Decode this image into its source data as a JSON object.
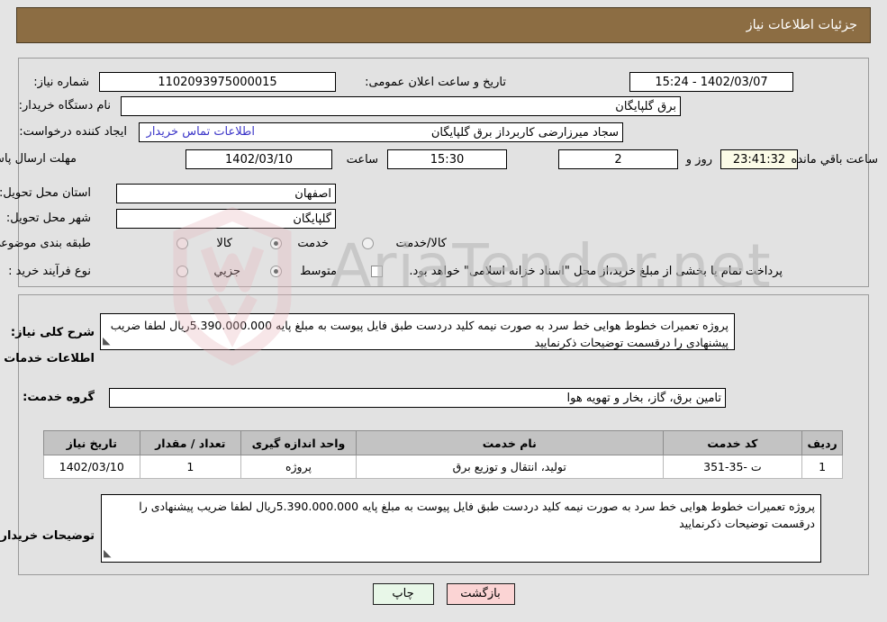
{
  "header": {
    "title": "جزئیات اطلاعات نیاز"
  },
  "colors": {
    "header_bg": "#8c6d43",
    "panel_bg": "#e2e2e2",
    "page_bg": "#e4e4e4",
    "link": "#3b35c8",
    "table_header_bg": "#c3c3c3",
    "print_btn_bg": "#e8f7e8",
    "back_btn_bg": "#fbd4d4",
    "countdown_bg": "#fbfbe7"
  },
  "form": {
    "need_number_label": "شماره نیاز:",
    "need_number_value": "1102093975000015",
    "announce_datetime_label": "تاریخ و ساعت اعلان عمومی:",
    "announce_datetime_value": "1402/03/07 - 15:24",
    "buyer_org_label": "نام دستگاه خریدار:",
    "buyer_org_value": "برق گلپایگان",
    "creator_label": "ایجاد کننده درخواست:",
    "creator_value": "سجاد میرزارضی کاربرداز برق گلپایگان",
    "contact_link": "اطلاعات تماس خریدار",
    "deadline_label": "مهلت ارسال پاسخ: تا تاریخ:",
    "deadline_date": "1402/03/10",
    "hour_label": "ساعت",
    "deadline_time": "15:30",
    "days_value": "2",
    "days_label": "روز و",
    "countdown_value": "23:41:32",
    "remaining_label": "ساعت باقي مانده",
    "province_label": "استان محل تحویل:",
    "province_value": "اصفهان",
    "city_label": "شهر محل تحویل:",
    "city_value": "گلپایگان",
    "category_label": "طبقه بندی موضوعی:",
    "category_options": [
      {
        "label": "کالا",
        "selected": false
      },
      {
        "label": "خدمت",
        "selected": true
      },
      {
        "label": "کالا/خدمت",
        "selected": false
      }
    ],
    "process_label": "نوع فرآیند خرید :",
    "process_options": [
      {
        "label": "جزیي",
        "selected": false
      },
      {
        "label": "متوسط",
        "selected": true
      }
    ],
    "treasury_checkbox_label": "پرداخت تمام یا بخشی از مبلغ خرید،از محل \"اسناد خزانه اسلامی\" خواهد بود.",
    "treasury_checked": false
  },
  "description": {
    "label": "شرح کلی نیاز:",
    "value": "پروژه تعمیرات خطوط هوایی خط سرد به صورت نیمه کلید دردست طبق فایل پیوست به مبلغ پایه 5.390.000.000ریال لطفا ضریب پیشنهادی را درقسمت توضیحات ذکرنمایید"
  },
  "services_section": {
    "heading": "اطلاعات خدمات مورد نیاز",
    "group_label": "گروه خدمت:",
    "group_value": "تامین برق، گاز، بخار و تهویه هوا"
  },
  "table": {
    "columns": [
      "ردیف",
      "کد خدمت",
      "نام خدمت",
      "واحد اندازه گیری",
      "تعداد / مقدار",
      "تاریخ نیاز"
    ],
    "rows": [
      {
        "row_no": "1",
        "service_code": "ت -35-351",
        "service_name": "تولید، انتقال و توزیع برق",
        "unit": "پروژه",
        "quantity": "1",
        "need_date": "1402/03/10"
      }
    ]
  },
  "buyer_notes": {
    "label": "توضیحات خریدار:",
    "value": "پروژه تعمیرات خطوط هوایی خط سرد به صورت نیمه کلید دردست طبق فایل پیوست به مبلغ پایه 5.390.000.000ریال لطفا ضریب پیشنهادی را درقسمت توضیحات ذکرنمایید"
  },
  "buttons": {
    "print": "چاپ",
    "back": "بازگشت"
  },
  "watermark": {
    "text": "AriaTender.net"
  }
}
